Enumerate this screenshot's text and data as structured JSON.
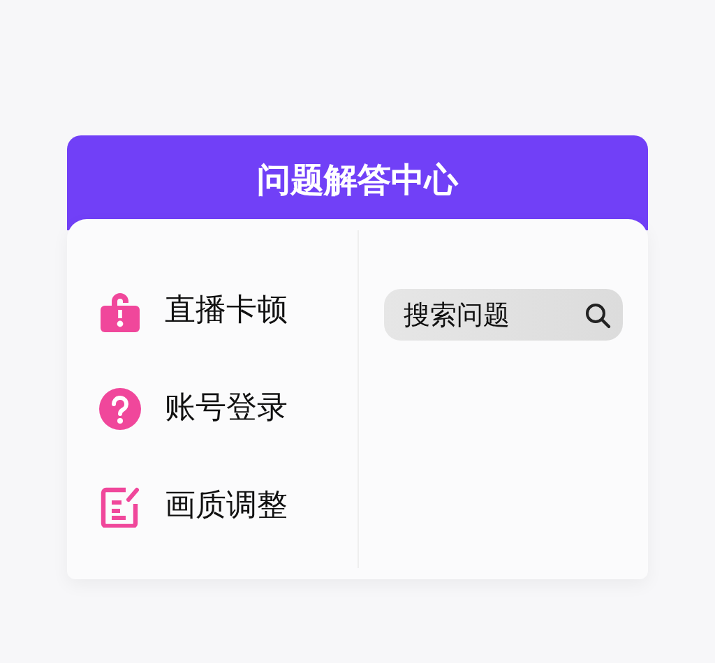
{
  "panel": {
    "title": "问题解答中心"
  },
  "topics": [
    {
      "kind": "lock",
      "label": "直播卡顿"
    },
    {
      "kind": "question",
      "label": "账号登录"
    },
    {
      "kind": "edit",
      "label": "画质调整"
    }
  ],
  "search": {
    "label": "搜索问题"
  }
}
